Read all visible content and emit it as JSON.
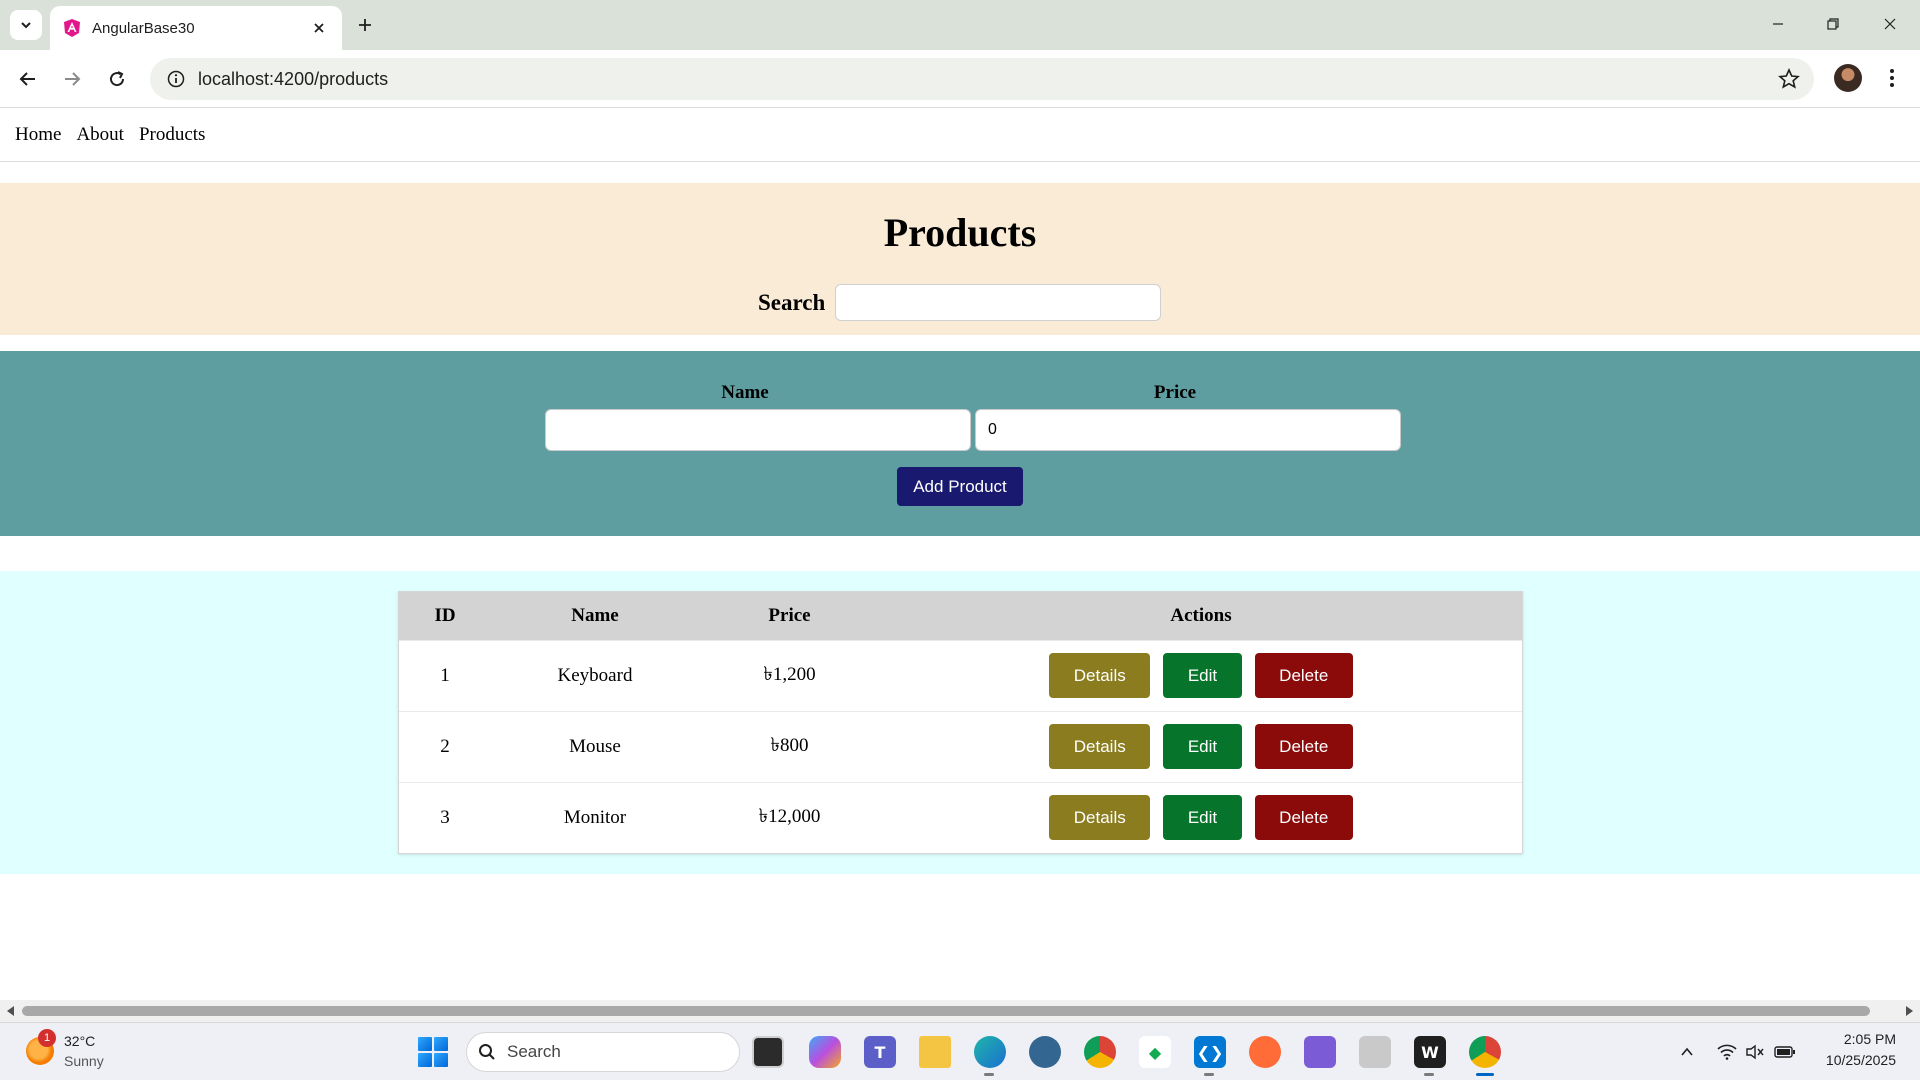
{
  "browser": {
    "tab_title": "AngularBase30",
    "url": "localhost:4200/products"
  },
  "app_nav": {
    "items": [
      {
        "label": "Home"
      },
      {
        "label": "About"
      },
      {
        "label": "Products"
      }
    ]
  },
  "header": {
    "title": "Products",
    "search_label": "Search",
    "search_value": ""
  },
  "form": {
    "name_label": "Name",
    "price_label": "Price",
    "name_value": "",
    "price_value": "0",
    "add_button_label": "Add Product"
  },
  "table": {
    "columns": [
      "ID",
      "Name",
      "Price",
      "Actions"
    ],
    "rows": [
      {
        "id": "1",
        "name": "Keyboard",
        "price": "৳1,200"
      },
      {
        "id": "2",
        "name": "Mouse",
        "price": "৳800"
      },
      {
        "id": "3",
        "name": "Monitor",
        "price": "৳12,000"
      }
    ],
    "actions": {
      "details_label": "Details",
      "edit_label": "Edit",
      "delete_label": "Delete"
    }
  },
  "taskbar": {
    "weather_temp": "32°C",
    "weather_condition": "Sunny",
    "weather_badge": "1",
    "search_placeholder": "Search",
    "time": "2:05 PM",
    "date": "10/25/2025"
  },
  "colors": {
    "hero_bg": "#faebd7",
    "form_bg": "#5f9ea0",
    "list_bg": "#e0ffff",
    "add_button": "#191970",
    "details_button": "#8b7d1f",
    "edit_button": "#06752b",
    "delete_button": "#8b0a0a"
  }
}
